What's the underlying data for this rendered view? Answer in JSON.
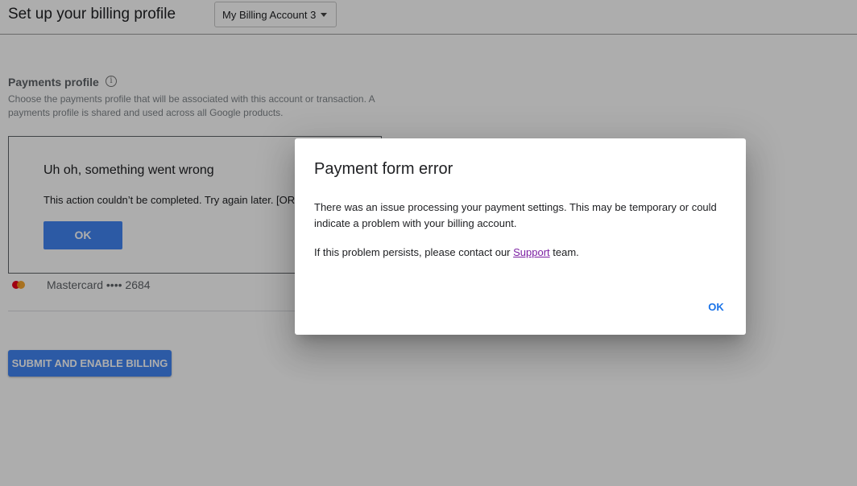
{
  "header": {
    "title": "Set up your billing profile",
    "account_select": "My Billing Account 3"
  },
  "payments_profile": {
    "title": "Payments profile",
    "info_glyph": "i",
    "description": "Choose the payments profile that will be associated with this account or transaction. A payments profile is shared and used across all Google products."
  },
  "error_panel": {
    "title": "Uh oh, something went wrong",
    "message": "This action couldn’t be completed. Try again later. [OR-",
    "ok_label": "OK"
  },
  "payment_method": {
    "label": "Mastercard •••• 2684"
  },
  "submit_label": "SUBMIT AND ENABLE BILLING",
  "dialog": {
    "title": "Payment form error",
    "body": "There was an issue processing your payment settings. This may be temporary or could indicate a problem with your billing account.",
    "persist_prefix": "If this problem persists, please contact our ",
    "support_link": "Support",
    "persist_suffix": " team.",
    "ok_label": "OK"
  },
  "colors": {
    "accent_blue": "#4285f4",
    "link_purple": "#7b1fa2",
    "dialog_button": "#1a73e8"
  }
}
